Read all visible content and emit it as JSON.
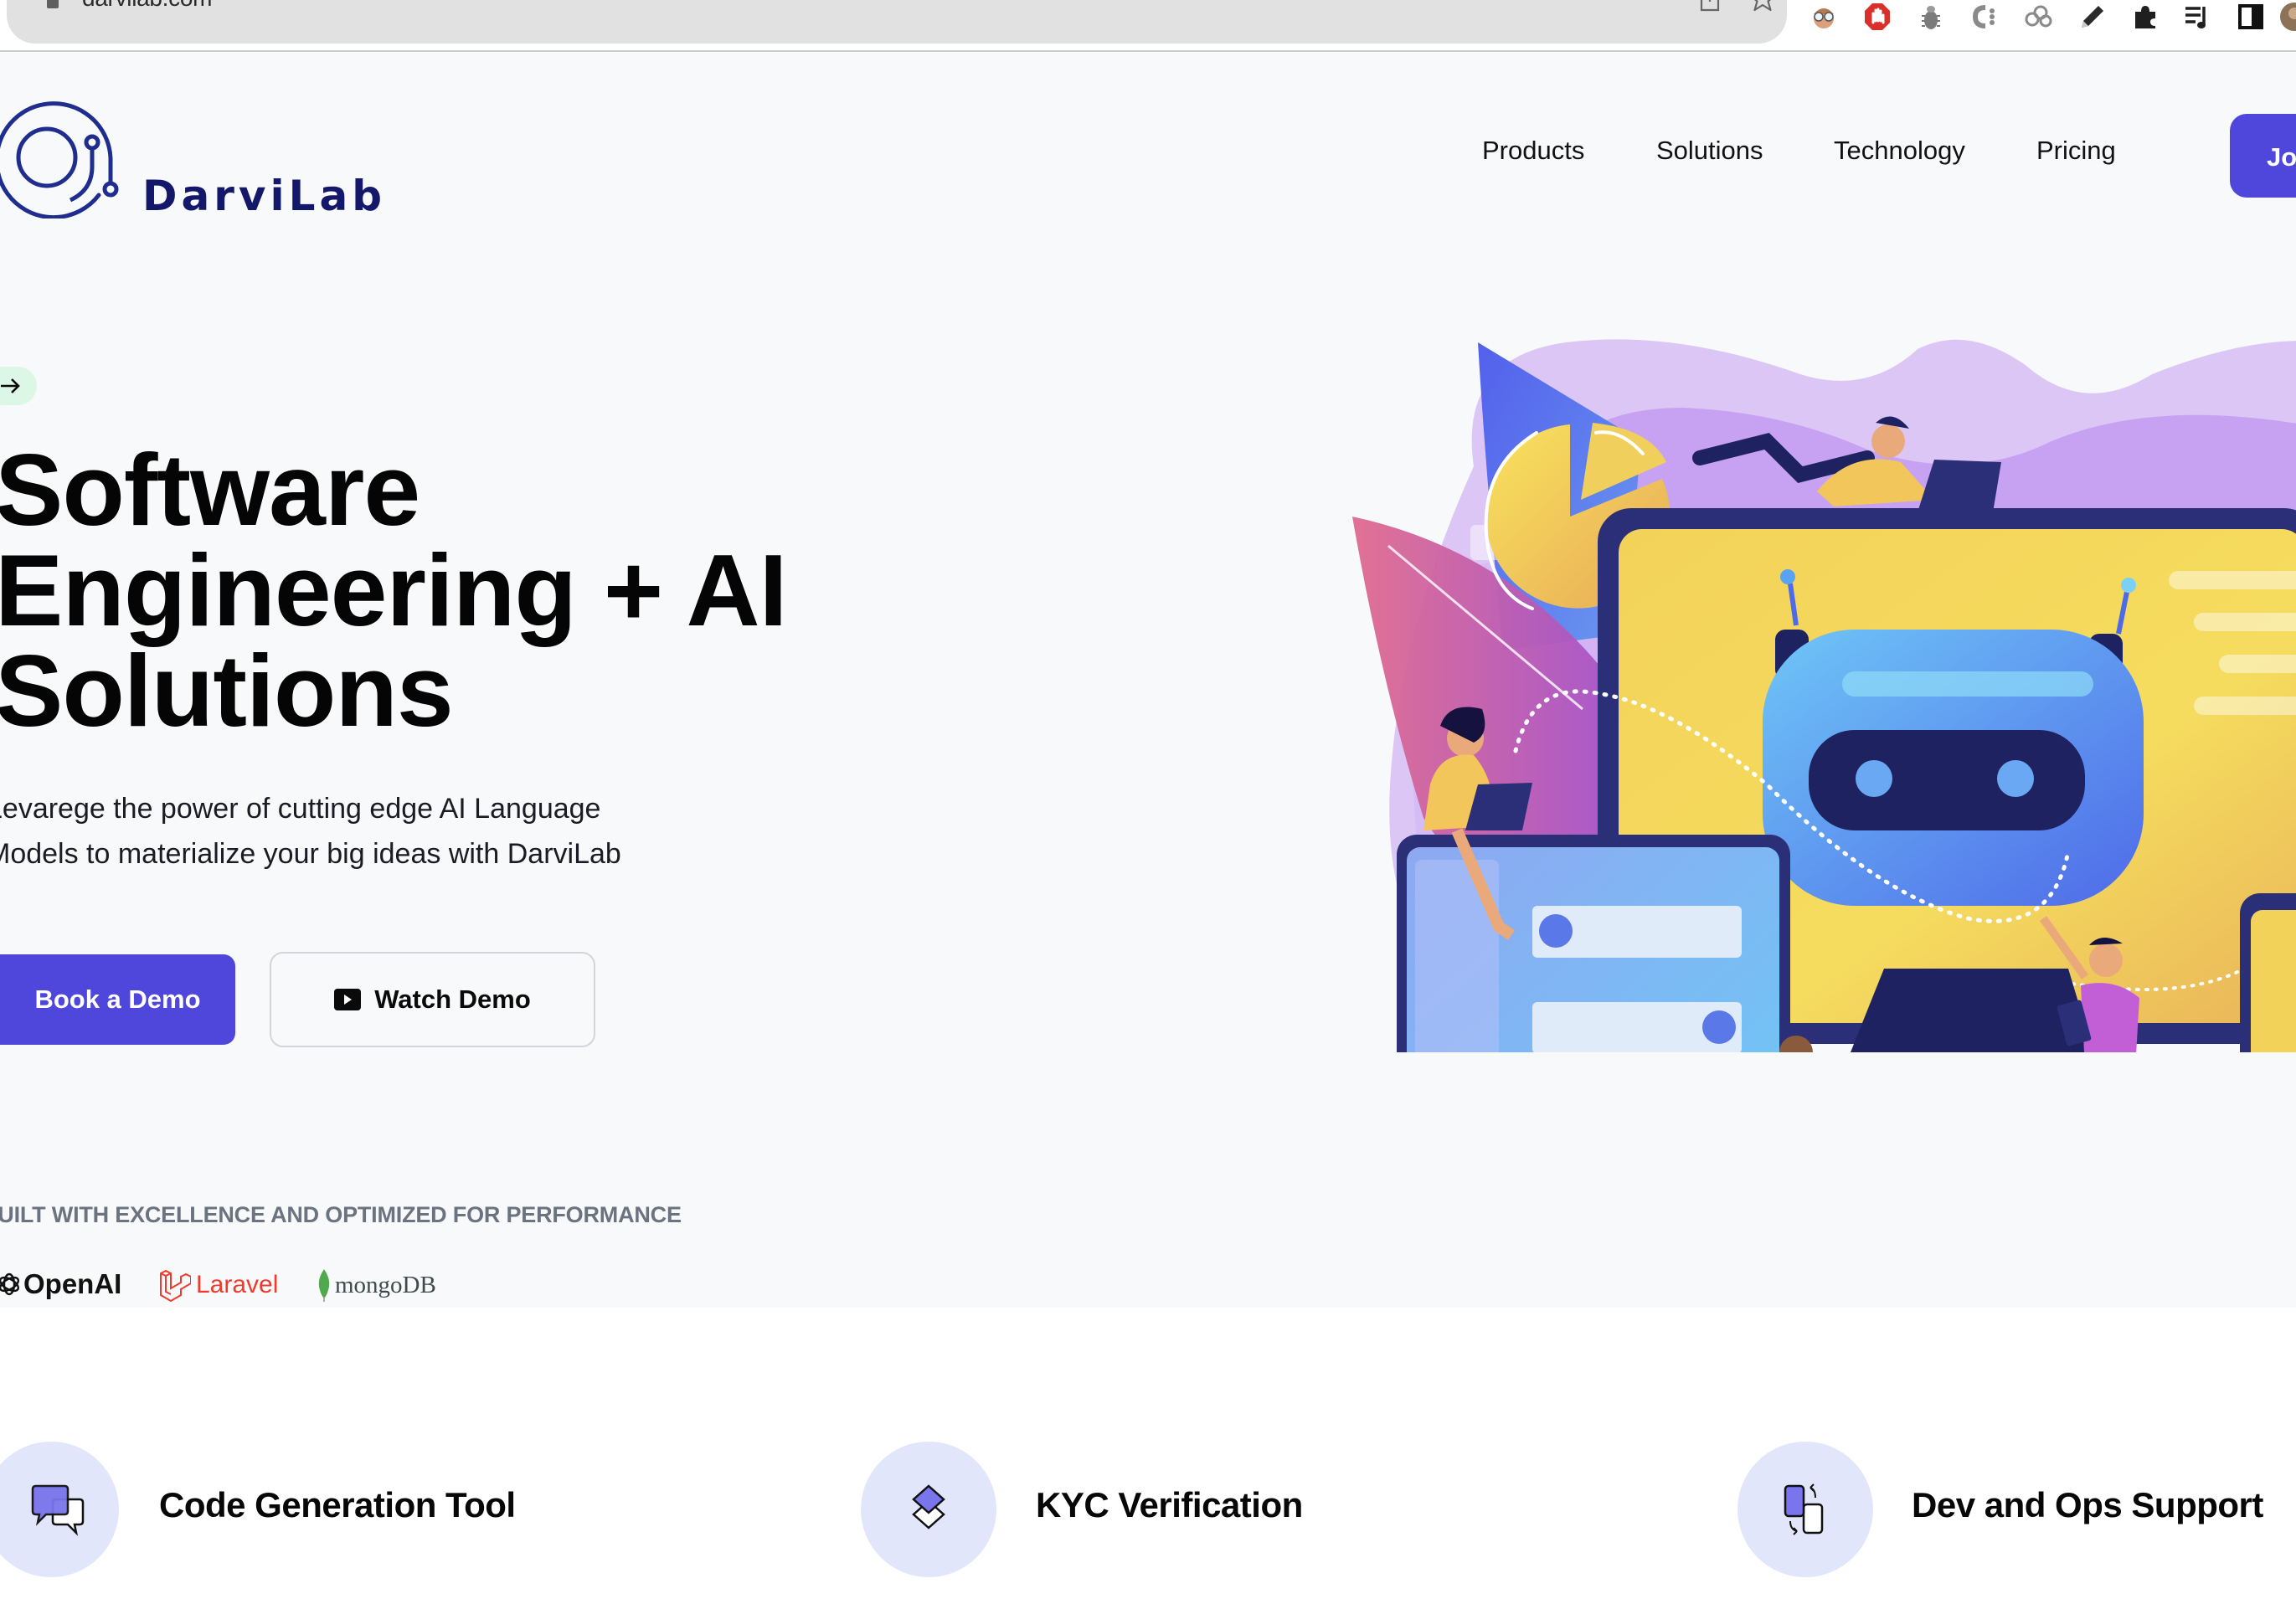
{
  "browser": {
    "url": "darvilab.com",
    "toolbar_icons": [
      "share-icon",
      "bookmark-star-icon"
    ],
    "extensions": [
      "avatar-extension-icon",
      "adblock-icon",
      "bug-icon",
      "css-extension-icon",
      "link-extension-icon",
      "pencil-icon",
      "puzzle-extensions-icon",
      "playlist-icon",
      "sidebar-toggle-icon",
      "profile-avatar-icon"
    ]
  },
  "header": {
    "brand_name": "DarviLab",
    "nav": [
      {
        "label": "Products"
      },
      {
        "label": "Solutions"
      },
      {
        "label": "Technology"
      },
      {
        "label": "Pricing"
      }
    ],
    "cta_label": "Join"
  },
  "hero": {
    "badge_icon": "arrow-right-icon",
    "headline_lines": [
      "Software",
      "Engineering + AI",
      "Solutions"
    ],
    "subtitle_lines": [
      "Levarege the power of cutting edge AI Language",
      "Models to materialize your big ideas with DarviLab"
    ],
    "primary_button": "Book a Demo",
    "secondary_button": "Watch Demo",
    "illustration_alt": "Team working with AI chatbot on monitor, laptop and phone"
  },
  "built_with": {
    "heading": "BUILT WITH EXCELLENCE AND OPTIMIZED FOR PERFORMANCE",
    "logos": [
      {
        "name": "OpenAI",
        "color": "#111111"
      },
      {
        "name": "Laravel",
        "color": "#ef3b2d"
      },
      {
        "name": "mongoDB",
        "color": "#3f4a4f",
        "accent": "#4fa94d"
      }
    ]
  },
  "features": [
    {
      "title": "Code Generation Tool",
      "icon": "chat-bubbles-icon"
    },
    {
      "title": "KYC Verification",
      "icon": "layers-icon"
    },
    {
      "title": "Dev and Ops Support",
      "icon": "swap-icon"
    }
  ],
  "colors": {
    "accent": "#4f46dc",
    "brand_navy": "#13186b",
    "hero_bg": "#f8f9fb",
    "feature_circle": "#e1e6fb",
    "badge_bg": "#dcf7e6"
  }
}
